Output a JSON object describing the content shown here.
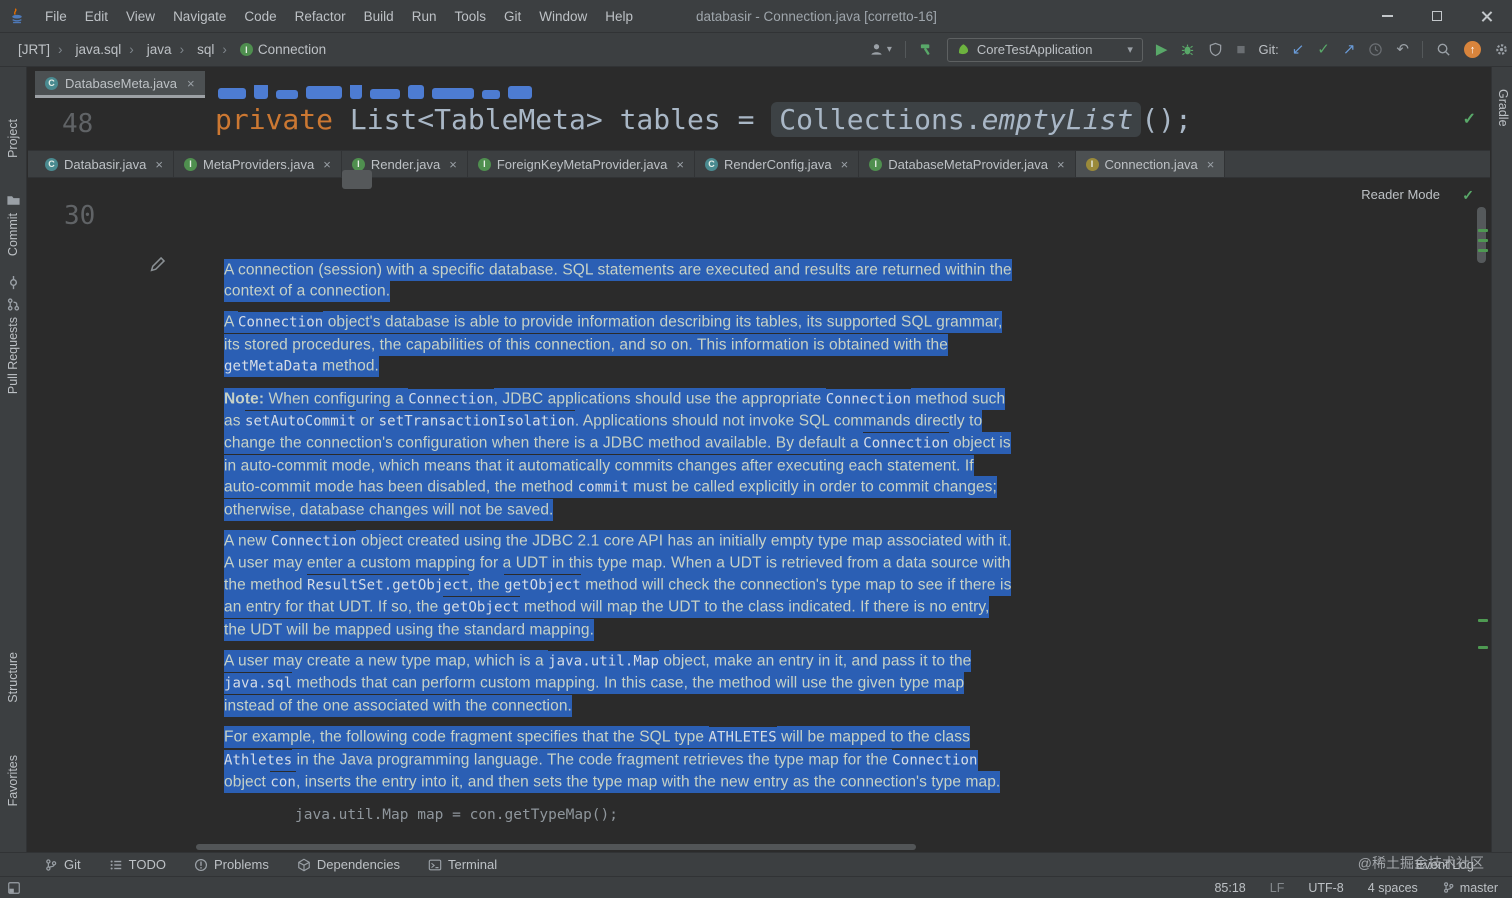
{
  "icons": {
    "close": "×",
    "dropdown": "▾",
    "run": "▶",
    "stop": "■",
    "check": "✓",
    "arrow_down_left": "↙",
    "arrow_up_right": "↗",
    "undo": "↶",
    "up_arrow": "↑"
  },
  "colors": {
    "selection": "#2b5fb4",
    "accent_green": "#59A869",
    "accent_orange": "#d8843c",
    "panel": "#3c3f41",
    "editor_bg": "#2b2b2b"
  },
  "title_bar": {
    "menus": [
      "File",
      "Edit",
      "View",
      "Navigate",
      "Code",
      "Refactor",
      "Build",
      "Run",
      "Tools",
      "Git",
      "Window",
      "Help"
    ],
    "title": "databasir - Connection.java [corretto-16]"
  },
  "nav_bar": {
    "breadcrumbs": [
      {
        "label": "[JRT]"
      },
      {
        "label": "java.sql"
      },
      {
        "label": "java"
      },
      {
        "label": "sql"
      },
      {
        "label": "Connection",
        "icon_letter": "I",
        "icon_color": "#4f8f4f"
      }
    ],
    "run_config": "CoreTestApplication",
    "git_label": "Git:"
  },
  "upper_editor": {
    "tab": {
      "label": "DatabaseMeta.java",
      "icon_letter": "C",
      "icon_color": "#4a8a90"
    },
    "line_number": "48",
    "code_line": {
      "keyword": "private ",
      "middle": "List<TableMeta> tables = ",
      "class_ref": "Collections",
      "dot": ".",
      "method": "emptyList",
      "suffix": "();"
    }
  },
  "tabs": [
    {
      "label": "Databasir.java",
      "icon_letter": "C",
      "icon_color": "#4a8a90"
    },
    {
      "label": "MetaProviders.java",
      "icon_letter": "I",
      "icon_color": "#4f8f4f"
    },
    {
      "label": "Render.java",
      "icon_letter": "I",
      "icon_color": "#4f8f4f"
    },
    {
      "label": "ForeignKeyMetaProvider.java",
      "icon_letter": "I",
      "icon_color": "#4f8f4f"
    },
    {
      "label": "RenderConfig.java",
      "icon_letter": "C",
      "icon_color": "#4a8a90"
    },
    {
      "label": "DatabaseMetaProvider.java",
      "icon_letter": "I",
      "icon_color": "#4f8f4f"
    },
    {
      "label": "Connection.java",
      "icon_letter": "I",
      "icon_color": "#9a8a3a",
      "active": true
    }
  ],
  "reader": {
    "mode_label": "Reader Mode",
    "line_number": "30",
    "paragraphs": [
      {
        "runs": [
          {
            "k": "t",
            "v": "A connection (session) with a specific database. SQL statements are executed and results are returned within the context of a connection."
          }
        ]
      },
      {
        "runs": [
          {
            "k": "t",
            "v": "A "
          },
          {
            "k": "c",
            "v": "Connection"
          },
          {
            "k": "t",
            "v": " object's database is able to provide information describing its tables, its supported SQL grammar, its stored procedures, the capabilities of this connection, and so on. This information is obtained with the "
          },
          {
            "k": "c",
            "v": "getMetaData"
          },
          {
            "k": "t",
            "v": " method."
          }
        ]
      },
      {
        "runs": [
          {
            "k": "b",
            "v": "Note:"
          },
          {
            "k": "t",
            "v": " When configuring a "
          },
          {
            "k": "c",
            "v": "Connection"
          },
          {
            "k": "t",
            "v": ", JDBC applications should use the appropriate "
          },
          {
            "k": "c",
            "v": "Connection"
          },
          {
            "k": "t",
            "v": " method such as "
          },
          {
            "k": "c",
            "v": "setAutoCommit"
          },
          {
            "k": "t",
            "v": " or "
          },
          {
            "k": "c",
            "v": "setTransactionIsolation"
          },
          {
            "k": "t",
            "v": ". Applications should not invoke SQL commands directly to change the connection's configuration when there is a JDBC method available. By default a "
          },
          {
            "k": "c",
            "v": "Connection"
          },
          {
            "k": "t",
            "v": " object is in auto-commit mode, which means that it automatically commits changes after executing each statement. If auto-commit mode has been disabled, the method "
          },
          {
            "k": "c",
            "v": "commit"
          },
          {
            "k": "t",
            "v": " must be called explicitly in order to commit changes; otherwise, database changes will not be saved."
          }
        ]
      },
      {
        "runs": [
          {
            "k": "t",
            "v": "A new "
          },
          {
            "k": "c",
            "v": "Connection"
          },
          {
            "k": "t",
            "v": " object created using the JDBC 2.1 core API has an initially empty type map associated with it. A user may enter a custom mapping for a UDT in this type map. When a UDT is retrieved from a data source with the method "
          },
          {
            "k": "c",
            "v": "ResultSet.getObject"
          },
          {
            "k": "t",
            "v": ", the "
          },
          {
            "k": "c",
            "v": "getObject"
          },
          {
            "k": "t",
            "v": " method will check the connection's type map to see if there is an entry for that UDT. If so, the "
          },
          {
            "k": "c",
            "v": "getObject"
          },
          {
            "k": "t",
            "v": " method will map the UDT to the class indicated. If there is no entry, the UDT will be mapped using the standard mapping."
          }
        ]
      },
      {
        "runs": [
          {
            "k": "t",
            "v": "A user may create a new type map, which is a "
          },
          {
            "k": "c",
            "v": "java.util.Map"
          },
          {
            "k": "t",
            "v": " object, make an entry in it, and pass it to the "
          },
          {
            "k": "c",
            "v": "java.sql"
          },
          {
            "k": "t",
            "v": " methods that can perform custom mapping. In this case, the method will use the given type map instead of the one associated with the connection."
          }
        ]
      },
      {
        "runs": [
          {
            "k": "t",
            "v": "For example, the following code fragment specifies that the SQL type "
          },
          {
            "k": "c",
            "v": "ATHLETES"
          },
          {
            "k": "t",
            "v": " will be mapped to the class "
          },
          {
            "k": "c",
            "v": "Athletes"
          },
          {
            "k": "t",
            "v": " in the Java programming language. The code fragment retrieves the type map for the "
          },
          {
            "k": "c",
            "v": "Connection"
          },
          {
            "k": "t",
            "v": " object "
          },
          {
            "k": "c",
            "v": "con"
          },
          {
            "k": "t",
            "v": ", inserts the entry into it, and then sets the type map with the new entry as the connection's type map."
          }
        ]
      }
    ],
    "code_line": "java.util.Map map = con.getTypeMap();"
  },
  "left_strip": {
    "project": "Project",
    "commit": "Commit",
    "pull_requests": "Pull Requests",
    "structure": "Structure",
    "favorites": "Favorites"
  },
  "right_strip": {
    "gradle": "Gradle"
  },
  "bottom_bar": {
    "buttons": [
      {
        "label": "Git",
        "icon": "branch"
      },
      {
        "label": "TODO",
        "icon": "todo"
      },
      {
        "label": "Problems",
        "icon": "problems"
      },
      {
        "label": "Dependencies",
        "icon": "deps"
      },
      {
        "label": "Terminal",
        "icon": "terminal"
      }
    ],
    "event_log": "Event Log",
    "watermark": "@稀土掘金技术社区"
  },
  "status_bar": {
    "caret": "85:18",
    "line_sep": "LF",
    "encoding": "UTF-8",
    "indent": "4 spaces",
    "branch": "master"
  }
}
